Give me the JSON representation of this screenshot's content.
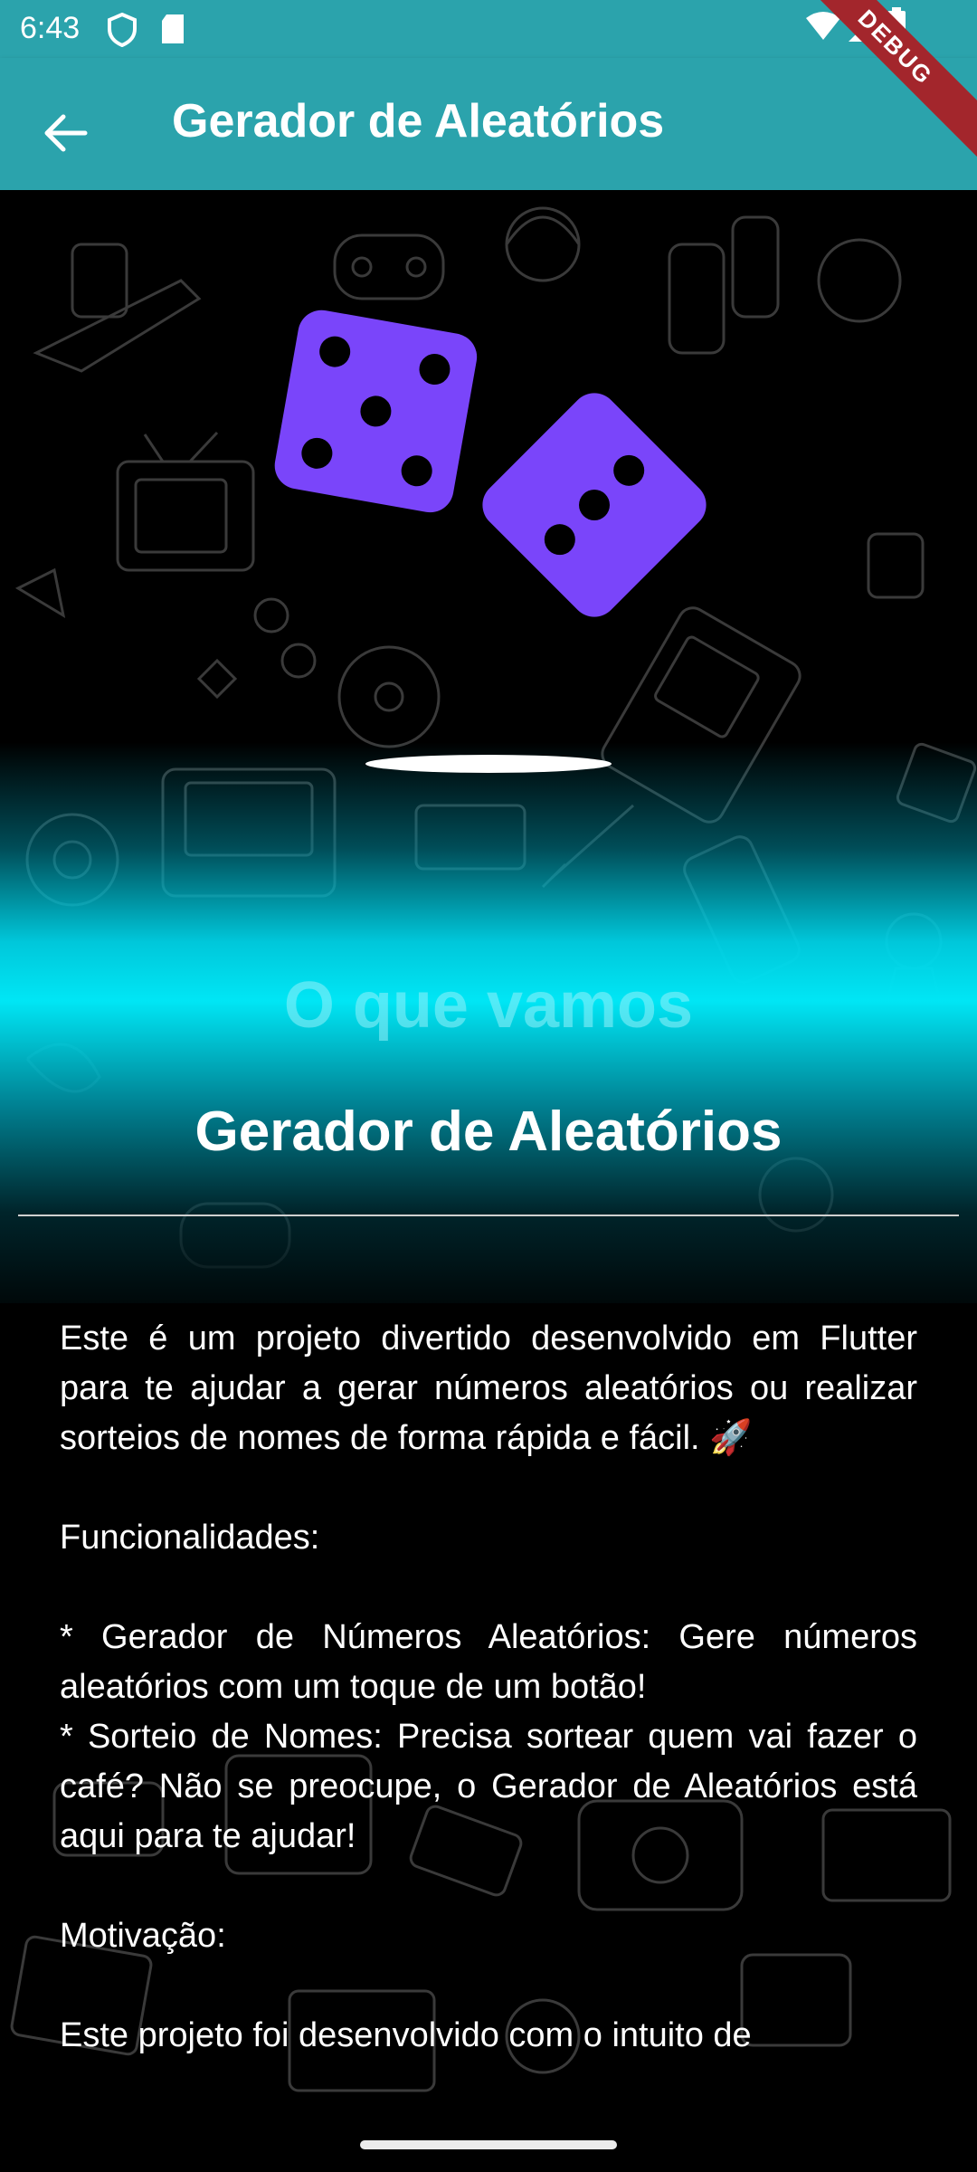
{
  "status_bar": {
    "time": "6:43",
    "icons": [
      "shield-icon",
      "sd-card-icon",
      "wifi-icon",
      "signal-icon",
      "battery-icon"
    ]
  },
  "debug_banner": "DEBUG",
  "app_bar": {
    "back_icon": "arrow-back-icon",
    "title": "Gerador de Aleatórios"
  },
  "hero": {
    "faded_heading": "O que vamos",
    "title": "Gerador de Aleatórios"
  },
  "description": {
    "intro": "Este é um projeto divertido desenvolvido em Flutter para te ajudar a gerar números aleatórios ou realizar sorteios de nomes de forma rápida e fácil. 🚀",
    "features_heading": "Funcionalidades:",
    "feature_1": "* Gerador de Números Aleatórios: Gere números aleatórios com um toque de um botão!",
    "feature_2": "* Sorteio de Nomes: Precisa sortear quem vai fazer o café? Não se preocupe, o Gerador de Aleatórios está aqui para te ajudar!",
    "motivation_heading": "Motivação:",
    "motivation_text": "Este projeto foi desenvolvido com o intuito de"
  },
  "colors": {
    "app_bar": "#2ba3ac",
    "dice": "#7a45fa",
    "cyan_glow": "#00e6f5",
    "debug_banner": "#a3262c"
  }
}
